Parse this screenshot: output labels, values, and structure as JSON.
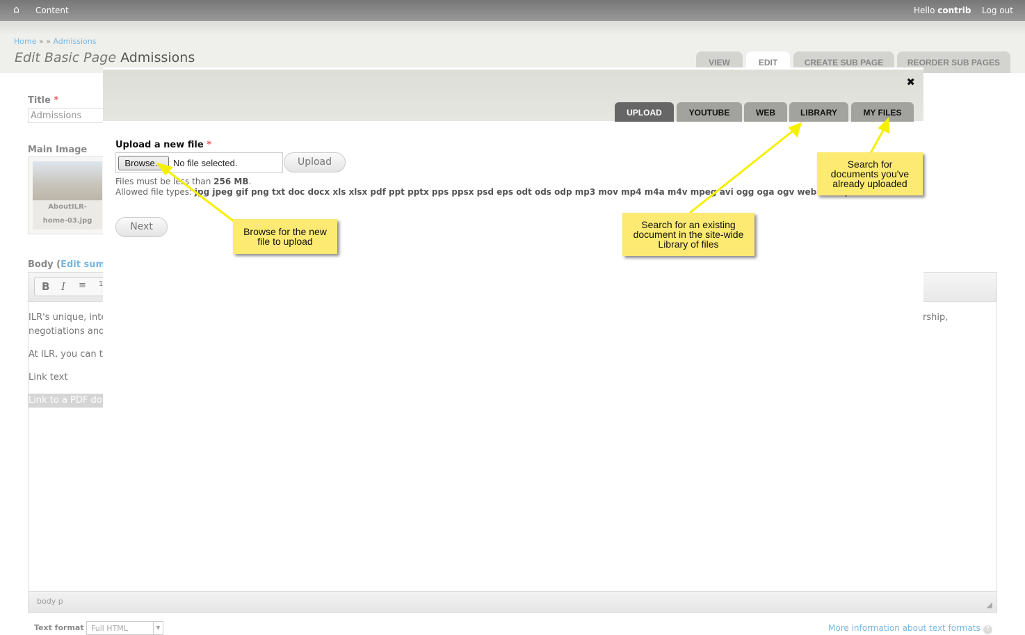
{
  "topbar": {
    "content": "Content",
    "hello": "Hello",
    "user": "contrib",
    "logout": "Log out"
  },
  "breadcrumb": {
    "home": "Home",
    "sep": "» »",
    "current": "Admissions"
  },
  "page": {
    "title_prefix": "Edit Basic Page",
    "title": "Admissions"
  },
  "page_tabs": [
    "VIEW",
    "EDIT",
    "CREATE SUB PAGE",
    "REORDER SUB PAGES"
  ],
  "form": {
    "title_label": "Title",
    "required": "*",
    "title_value": "Admissions",
    "main_image_label": "Main Image",
    "image_caption_1": "AboutILR-",
    "image_caption_2": "home-03.jpg",
    "body_label": "Body (",
    "body_link": "Edit summ",
    "body_lines": [
      "ILR's unique, inte",
      "negotiations and",
      "At ILR, you can t",
      "Link text",
      "Link to a PDF do"
    ],
    "body_right": "rship,",
    "status_path": "body  p",
    "text_format_label": "Text format",
    "text_format_value": "Full HTML",
    "more_info": "More information about text formats"
  },
  "modal": {
    "tabs": [
      "UPLOAD",
      "YOUTUBE",
      "WEB",
      "LIBRARY",
      "MY FILES"
    ],
    "active_tab": "UPLOAD",
    "upload_label": "Upload a new file",
    "browse": "Browse...",
    "no_file": "No file selected.",
    "upload_button": "Upload",
    "size_text": "Files must be less than",
    "size_value": "256 MB",
    "types_label": "Allowed file types:",
    "types": "jpg jpeg gif png txt doc docx xls xlsx pdf ppt pptx pps ppsx psd eps odt ods odp mp3 mov mp4 m4a m4v mpeg avi ogg oga ogv weba webp webm r",
    "next_button": "Next"
  },
  "callouts": {
    "browse": [
      "Browse for the new",
      "file to upload"
    ],
    "library": [
      "Search for an existing",
      "document in the site-wide",
      "Library of files"
    ],
    "myfiles": [
      "Search for",
      "documents you've",
      "already uploaded"
    ]
  },
  "colors": {
    "callout": "#fdea72",
    "arrow": "#f5f000",
    "active_tab": "#666666",
    "link": "#7ab6e0"
  }
}
